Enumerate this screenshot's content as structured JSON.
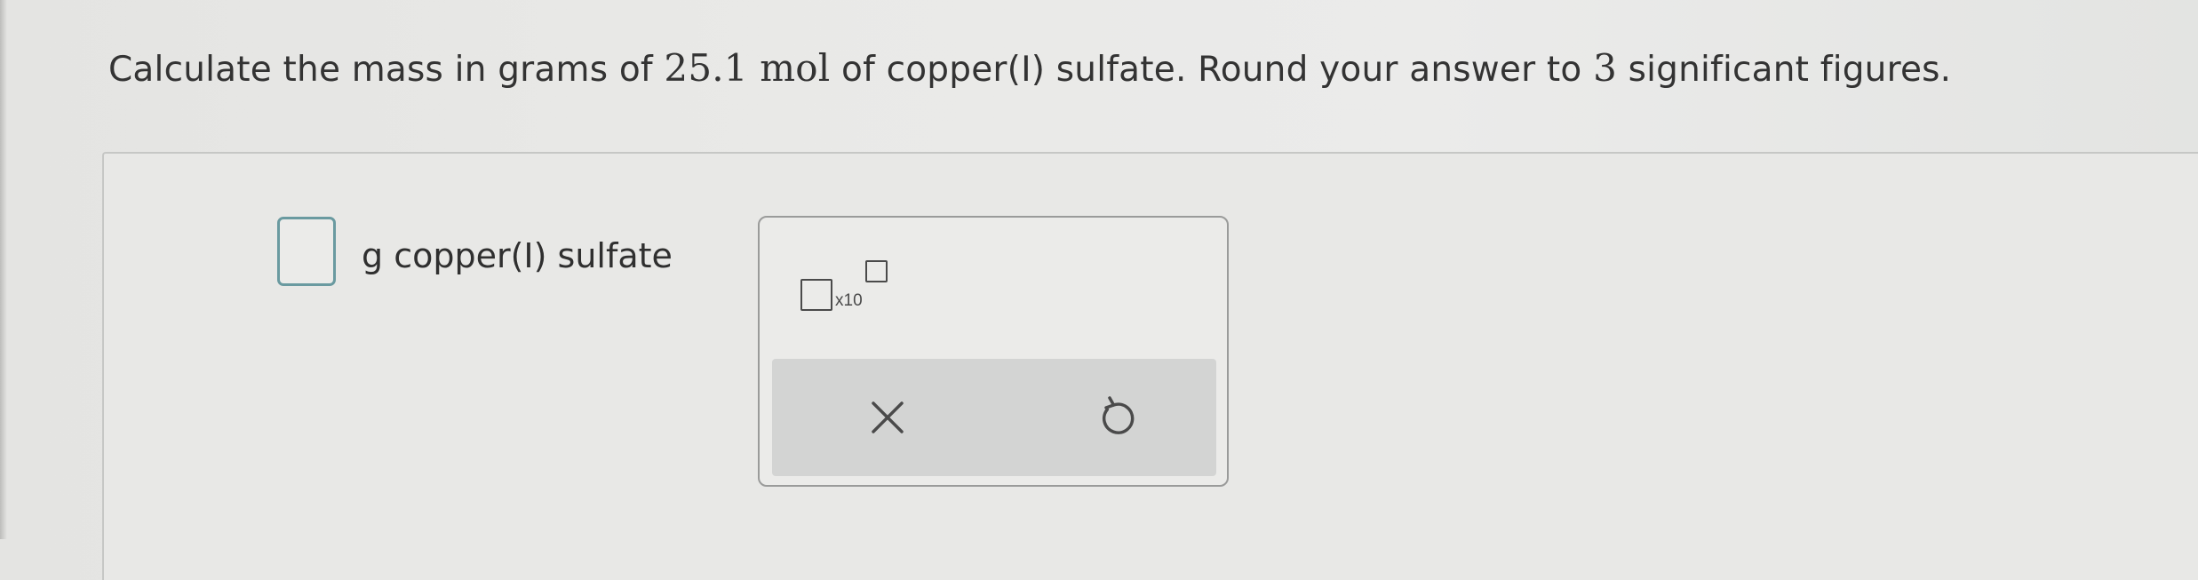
{
  "question": {
    "pre": "Calculate the mass in grams of ",
    "amount": "25.1 mol",
    "mid": " of copper(I) sulfate. Round your answer to ",
    "sig_figs": "3",
    "post": " significant figures."
  },
  "answer": {
    "value": "",
    "unit_label": "g copper(I) sulfate"
  },
  "palette": {
    "sci_notation_label": "x10",
    "clear_icon": "x-icon",
    "undo_icon": "undo-icon"
  },
  "colors": {
    "input_border": "#6a9aa0",
    "action_bar": "#d3d4d3",
    "icon": "#4a4a4a"
  }
}
